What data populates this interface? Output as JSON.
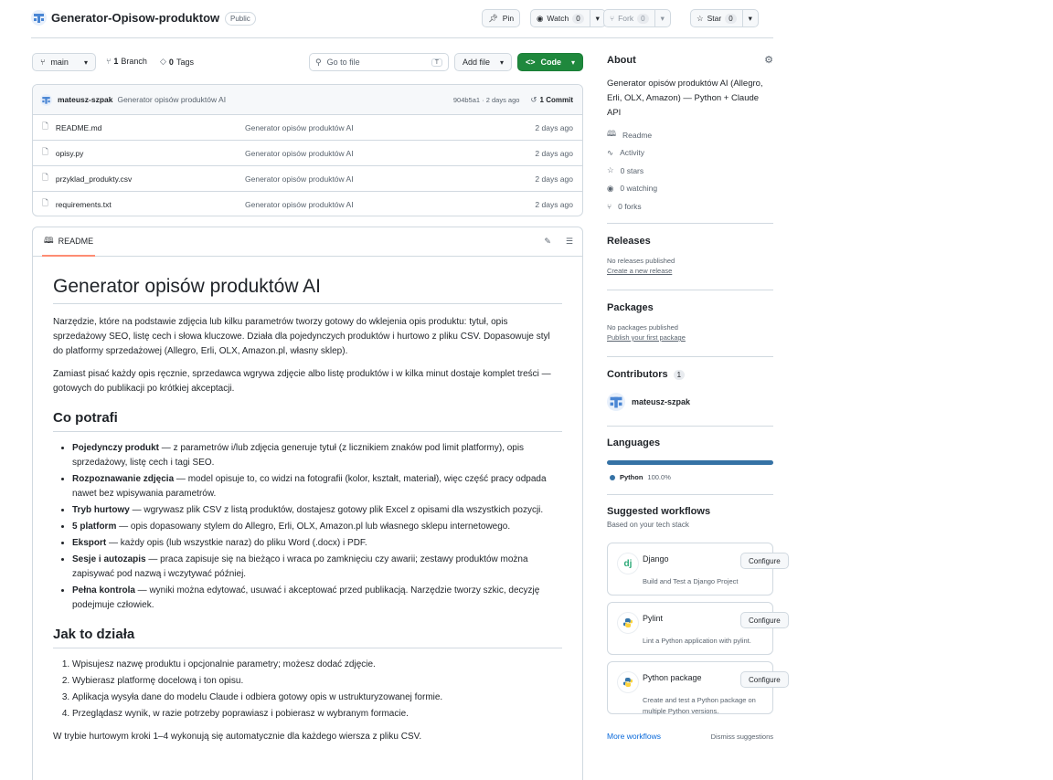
{
  "repo": {
    "name": "Generator-Opisow-produktow",
    "visibility": "Public",
    "pin_label": "Pin",
    "watch_label": "Watch",
    "watch_count": "0",
    "fork_label": "Fork",
    "fork_count": "0",
    "star_label": "Star",
    "star_count": "0"
  },
  "toolbar": {
    "branch": "main",
    "branches_count": "1",
    "branches_label": "Branch",
    "tags_count": "0",
    "tags_label": "Tags",
    "goto_placeholder": "Go to file",
    "goto_shortcut": "T",
    "add_file_label": "Add file",
    "code_label": "Code"
  },
  "commit": {
    "author": "mateusz-szpak",
    "message": "Generator opisów produktów AI",
    "hash_date": "904b5a1 · 2 days ago",
    "commits_label": "1 Commit"
  },
  "files": [
    {
      "name": "README.md",
      "message": "Generator opisów produktów AI",
      "date": "2 days ago"
    },
    {
      "name": "opisy.py",
      "message": "Generator opisów produktów AI",
      "date": "2 days ago"
    },
    {
      "name": "przyklad_produkty.csv",
      "message": "Generator opisów produktów AI",
      "date": "2 days ago"
    },
    {
      "name": "requirements.txt",
      "message": "Generator opisów produktów AI",
      "date": "2 days ago"
    }
  ],
  "readme": {
    "tab_label": "README",
    "title": "Generator opisów produktów AI",
    "intro1": "Narzędzie, które na podstawie zdjęcia lub kilku parametrów tworzy gotowy do wklejenia opis produktu: tytuł, opis sprzedażowy SEO, listę cech i słowa kluczowe. Działa dla pojedynczych produktów i hurtowo z pliku CSV. Dopasowuje styl do platformy sprzedażowej (Allegro, Erli, OLX, Amazon.pl, własny sklep).",
    "intro2": "Zamiast pisać każdy opis ręcznie, sprzedawca wgrywa zdjęcie albo listę produktów i w kilka minut dostaje komplet treści — gotowych do publikacji po krótkiej akceptacji.",
    "h_features": "Co potrafi",
    "features": [
      {
        "bold": "Pojedynczy produkt",
        "text": " — z parametrów i/lub zdjęcia generuje tytuł (z licznikiem znaków pod limit platformy), opis sprzedażowy, listę cech i tagi SEO."
      },
      {
        "bold": "Rozpoznawanie zdjęcia",
        "text": " — model opisuje to, co widzi na fotografii (kolor, kształt, materiał), więc część pracy odpada nawet bez wpisywania parametrów."
      },
      {
        "bold": "Tryb hurtowy",
        "text": " — wgrywasz plik CSV z listą produktów, dostajesz gotowy plik Excel z opisami dla wszystkich pozycji."
      },
      {
        "bold": "5 platform",
        "text": " — opis dopasowany stylem do Allegro, Erli, OLX, Amazon.pl lub własnego sklepu internetowego."
      },
      {
        "bold": "Eksport",
        "text": " — każdy opis (lub wszystkie naraz) do pliku Word (.docx) i PDF."
      },
      {
        "bold": "Sesje i autozapis",
        "text": " — praca zapisuje się na bieżąco i wraca po zamknięciu czy awarii; zestawy produktów można zapisywać pod nazwą i wczytywać później."
      },
      {
        "bold": "Pełna kontrola",
        "text": " — wyniki można edytować, usuwać i akceptować przed publikacją. Narzędzie tworzy szkic, decyzję podejmuje człowiek."
      }
    ],
    "h_how": "Jak to działa",
    "steps": [
      "Wpisujesz nazwę produktu i opcjonalnie parametry; możesz dodać zdjęcie.",
      "Wybierasz platformę docelową i ton opisu.",
      "Aplikacja wysyła dane do modelu Claude i odbiera gotowy opis w ustrukturyzowanej formie.",
      "Przeglądasz wynik, w razie potrzeby poprawiasz i pobierasz w wybranym formacie."
    ],
    "outro": "W trybie hurtowym kroki 1–4 wykonują się automatycznie dla każdego wiersza z pliku CSV."
  },
  "about": {
    "heading": "About",
    "description": "Generator opisów produktów AI (Allegro, Erli, OLX, Amazon) — Python + Claude API",
    "readme": "Readme",
    "activity": "Activity",
    "stars": "0 stars",
    "watching": "0 watching",
    "forks": "0 forks"
  },
  "releases": {
    "heading": "Releases",
    "empty": "No releases published",
    "create_link": "Create a new release"
  },
  "packages": {
    "heading": "Packages",
    "empty": "No packages published",
    "publish_link": "Publish your first package"
  },
  "contributors": {
    "heading": "Contributors",
    "count": "1",
    "name": "mateusz-szpak"
  },
  "languages": {
    "heading": "Languages",
    "name": "Python",
    "percent": "100.0%",
    "share": 1.0,
    "color": "#3572A5"
  },
  "workflows": {
    "heading": "Suggested workflows",
    "subheading": "Based on your tech stack",
    "items": [
      {
        "logo": "dj",
        "name": "Django",
        "desc": "Build and Test a Django Project",
        "button": "Configure"
      },
      {
        "logo": "py",
        "name": "Pylint",
        "desc": "Lint a Python application with pylint.",
        "button": "Configure"
      },
      {
        "logo": "py",
        "name": "Python package",
        "desc": "Create and test a Python package on multiple Python versions.",
        "button": "Configure"
      }
    ],
    "more_link": "More workflows",
    "dismiss_link": "Dismiss suggestions"
  }
}
